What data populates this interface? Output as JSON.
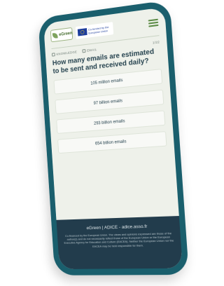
{
  "header": {
    "logo_text": "eGreen",
    "eu_logo_text": "Co-funded by the European Union"
  },
  "meta": {
    "tags": [
      "KNOWLEDGE",
      "EMAIL"
    ],
    "counter": "1/22"
  },
  "question": "How many emails are estimated to be sent and received daily?",
  "answers": [
    "105 million emails",
    "97 billion emails",
    "293 billion emails",
    "654 billion emails"
  ],
  "footer": {
    "brand": "eGreen | ADICE - ",
    "link": "adice.asso.fr",
    "disclaimer": "Co-financed by the European Union. The views and opinions expressed are those of the author(s) and do not necessarily reflect those of the European Union or the European Executive Agency for Education and Culture (EACEA). Neither the European Union nor the EACEA may be held responsible for them."
  },
  "colors": {
    "phone_frame": "#1a5f6d",
    "screen_bg": "#eef1ea",
    "question_text": "#26434f",
    "footer_bg": "#223c4c",
    "brand_green": "#7ea35e"
  }
}
